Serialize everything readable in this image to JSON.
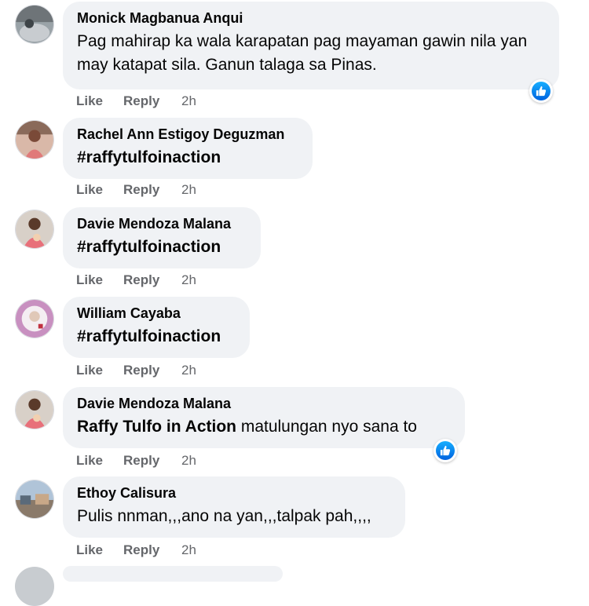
{
  "comments": [
    {
      "author": "Monick Magbanua Anqui",
      "text": "Pag mahirap ka wala karapatan pag mayaman gawin nila yan may katapat sila. Ganun talaga sa Pinas.",
      "like": "Like",
      "reply": "Reply",
      "time": "2h",
      "reaction": "like-icon"
    },
    {
      "author": "Rachel Ann Estigoy Deguzman",
      "text": "#raffytulfoinaction",
      "like": "Like",
      "reply": "Reply",
      "time": "2h"
    },
    {
      "author": "Davie Mendoza Malana",
      "text": "#raffytulfoinaction",
      "like": "Like",
      "reply": "Reply",
      "time": "2h"
    },
    {
      "author": "William Cayaba",
      "text": "#raffytulfoinaction",
      "like": "Like",
      "reply": "Reply",
      "time": "2h"
    },
    {
      "author": "Davie Mendoza Malana",
      "mention": "Raffy Tulfo in Action",
      "text": "matulungan nyo sana to",
      "like": "Like",
      "reply": "Reply",
      "time": "2h",
      "reaction": "like-icon"
    },
    {
      "author": "Ethoy Calisura",
      "text": "Pulis nnman,,,ano na yan,,,talpak pah,,,,",
      "like": "Like",
      "reply": "Reply",
      "time": "2h"
    }
  ],
  "colors": {
    "bubble": "#f0f2f5",
    "action_text": "#65676b",
    "like_blue": "#1877f2"
  }
}
